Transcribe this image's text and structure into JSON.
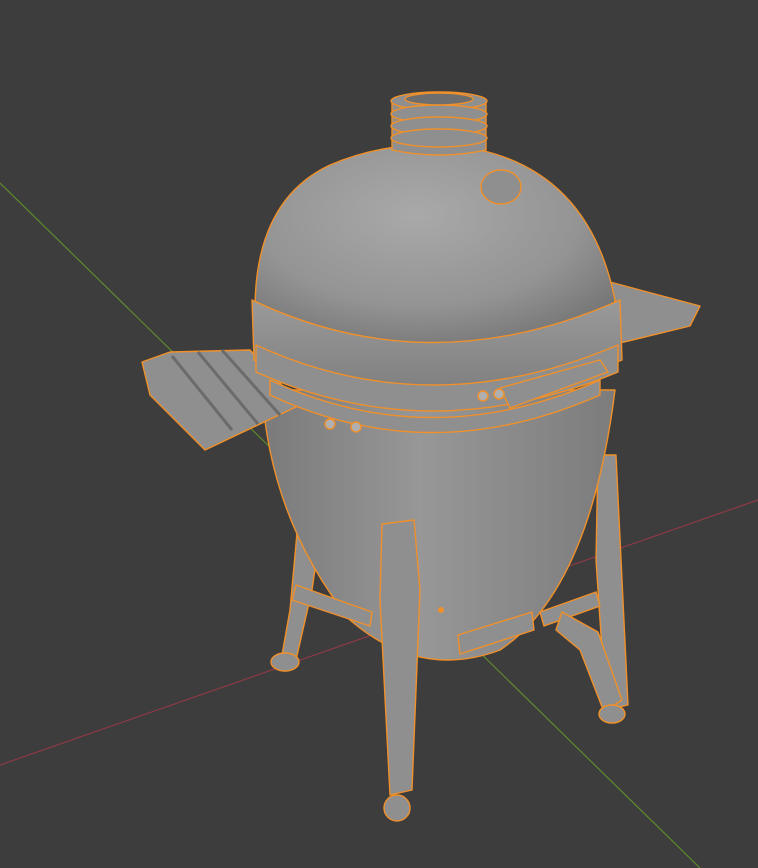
{
  "viewport": {
    "background": "#3d3d3d",
    "mode": "solid-shading"
  },
  "axes": {
    "x_axis_color": "#8c3a45",
    "y_axis_color": "#5e8a2e"
  },
  "object": {
    "kind": "kamado-grill",
    "selected": true,
    "outline_color": "#f0902a",
    "body_color": "#8f8f8f",
    "origin_color": "#f0902a"
  }
}
